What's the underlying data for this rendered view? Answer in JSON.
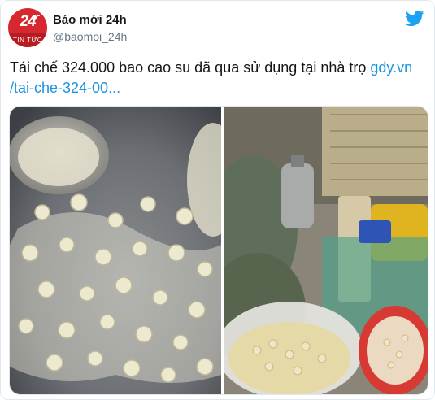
{
  "account": {
    "name": "Báo mới 24h",
    "handle": "@baomoi_24h",
    "avatar_number": "24",
    "avatar_caption": "TIN TỨC"
  },
  "tweet": {
    "text": "Tái chế 324.000 bao cao su đã qua sử dụng tại nhà trọ",
    "link_line1": "gdy.vn",
    "link_line2": "/tai-che-324-00..."
  },
  "icons": {
    "brand": "twitter-bird-icon"
  },
  "colors": {
    "link": "#1b95e0",
    "brand": "#1da1f2",
    "avatar": "#d7282f"
  }
}
